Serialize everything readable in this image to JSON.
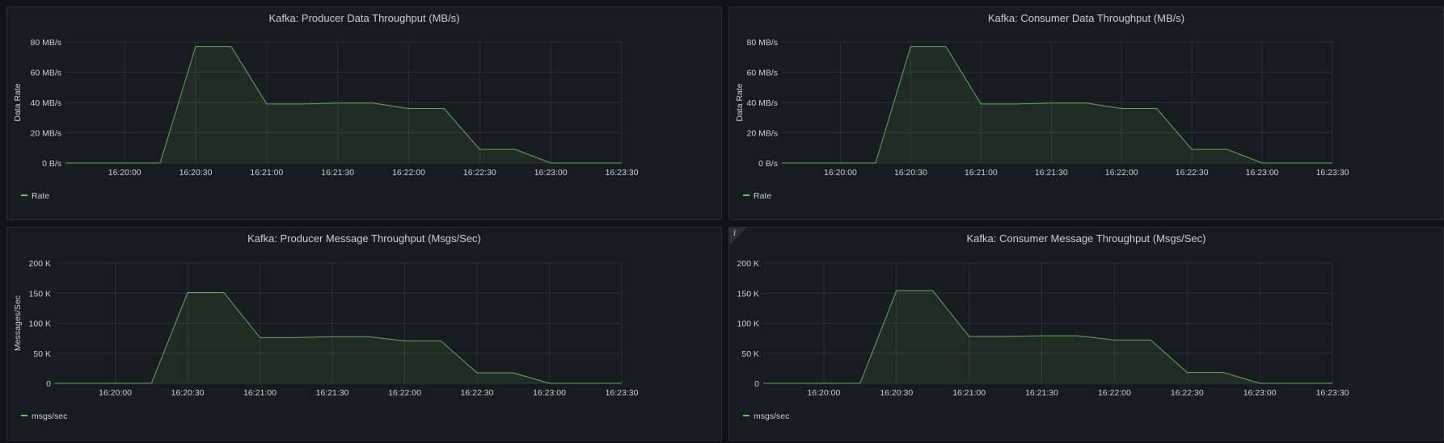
{
  "colors": {
    "background": "#111217",
    "panel": "#181b1f",
    "grid": "#2c2f35",
    "series_line": "#73bf69",
    "series_fill": "#73bf69",
    "text": "#ccccdc",
    "axis_text": "#c7d0d9"
  },
  "chart_data": [
    {
      "type": "area",
      "title": "Kafka: Producer Data Throughput (MB/s)",
      "ylabel": "Data Rate",
      "xlabel": "",
      "y_ticks": [
        "0 B/s",
        "20 MB/s",
        "40 MB/s",
        "60 MB/s",
        "80 MB/s"
      ],
      "y_tick_values": [
        0,
        20,
        40,
        60,
        80
      ],
      "ylim": [
        0,
        80
      ],
      "x_ticks": [
        "16:20:00",
        "16:20:30",
        "16:21:00",
        "16:21:30",
        "16:22:00",
        "16:22:30",
        "16:23:00",
        "16:23:30"
      ],
      "xlim": [
        "16:19:35",
        "16:23:30"
      ],
      "grid": true,
      "legend_position": "bottom-left",
      "series": [
        {
          "name": "Rate",
          "x": [
            "16:19:35",
            "16:20:00",
            "16:20:15",
            "16:20:30",
            "16:20:45",
            "16:21:00",
            "16:21:15",
            "16:21:30",
            "16:21:45",
            "16:22:00",
            "16:22:15",
            "16:22:30",
            "16:22:45",
            "16:23:00",
            "16:23:15",
            "16:23:30"
          ],
          "values": [
            0,
            0,
            0,
            77,
            77,
            39,
            39,
            39.6,
            39.6,
            36,
            36,
            9,
            9,
            0,
            0,
            0
          ]
        }
      ]
    },
    {
      "type": "area",
      "title": "Kafka: Consumer Data Throughput (MB/s)",
      "ylabel": "Data Rate",
      "xlabel": "",
      "y_ticks": [
        "0 B/s",
        "20 MB/s",
        "40 MB/s",
        "60 MB/s",
        "80 MB/s"
      ],
      "y_tick_values": [
        0,
        20,
        40,
        60,
        80
      ],
      "ylim": [
        0,
        80
      ],
      "x_ticks": [
        "16:20:00",
        "16:20:30",
        "16:21:00",
        "16:21:30",
        "16:22:00",
        "16:22:30",
        "16:23:00",
        "16:23:30"
      ],
      "xlim": [
        "16:19:35",
        "16:23:30"
      ],
      "grid": true,
      "legend_position": "bottom-left",
      "series": [
        {
          "name": "Rate",
          "x": [
            "16:19:35",
            "16:20:00",
            "16:20:15",
            "16:20:30",
            "16:20:45",
            "16:21:00",
            "16:21:15",
            "16:21:30",
            "16:21:45",
            "16:22:00",
            "16:22:15",
            "16:22:30",
            "16:22:45",
            "16:23:00",
            "16:23:15",
            "16:23:30"
          ],
          "values": [
            0,
            0,
            0,
            77,
            77,
            39,
            39,
            39.6,
            39.6,
            36,
            36,
            9,
            9,
            0,
            0,
            0
          ]
        }
      ]
    },
    {
      "type": "area",
      "title": "Kafka: Producer Message Throughput (Msgs/Sec)",
      "ylabel": "Messages/Sec",
      "xlabel": "",
      "y_ticks": [
        "0",
        "50 K",
        "100 K",
        "150 K",
        "200 K"
      ],
      "y_tick_values": [
        0,
        50000,
        100000,
        150000,
        200000
      ],
      "ylim": [
        0,
        200000
      ],
      "x_ticks": [
        "16:20:00",
        "16:20:30",
        "16:21:00",
        "16:21:30",
        "16:22:00",
        "16:22:30",
        "16:23:00",
        "16:23:30"
      ],
      "xlim": [
        "16:19:35",
        "16:23:30"
      ],
      "grid": true,
      "legend_position": "bottom-left",
      "series": [
        {
          "name": "msgs/sec",
          "x": [
            "16:19:35",
            "16:20:00",
            "16:20:15",
            "16:20:30",
            "16:20:45",
            "16:21:00",
            "16:21:15",
            "16:21:30",
            "16:21:45",
            "16:22:00",
            "16:22:15",
            "16:22:30",
            "16:22:45",
            "16:23:00",
            "16:23:15",
            "16:23:30"
          ],
          "values": [
            0,
            0,
            0,
            151000,
            151000,
            76000,
            76000,
            77500,
            77500,
            70500,
            70500,
            17500,
            17500,
            0,
            0,
            0
          ]
        }
      ]
    },
    {
      "type": "area",
      "title": "Kafka: Consumer Message Throughput (Msgs/Sec)",
      "ylabel": "",
      "xlabel": "",
      "info_icon": "i",
      "y_ticks": [
        "0",
        "50 K",
        "100 K",
        "150 K",
        "200 K"
      ],
      "y_tick_values": [
        0,
        50000,
        100000,
        150000,
        200000
      ],
      "ylim": [
        0,
        200000
      ],
      "x_ticks": [
        "16:20:00",
        "16:20:30",
        "16:21:00",
        "16:21:30",
        "16:22:00",
        "16:22:30",
        "16:23:00",
        "16:23:30"
      ],
      "xlim": [
        "16:19:35",
        "16:23:30"
      ],
      "grid": true,
      "legend_position": "bottom-left",
      "series": [
        {
          "name": "msgs/sec",
          "x": [
            "16:19:35",
            "16:20:00",
            "16:20:15",
            "16:20:30",
            "16:20:45",
            "16:21:00",
            "16:21:15",
            "16:21:30",
            "16:21:45",
            "16:22:00",
            "16:22:15",
            "16:22:30",
            "16:22:45",
            "16:23:00",
            "16:23:15",
            "16:23:30"
          ],
          "values": [
            0,
            0,
            0,
            154000,
            154000,
            78000,
            78000,
            79000,
            79000,
            72000,
            72000,
            18000,
            18000,
            0,
            0,
            0
          ]
        }
      ]
    }
  ]
}
